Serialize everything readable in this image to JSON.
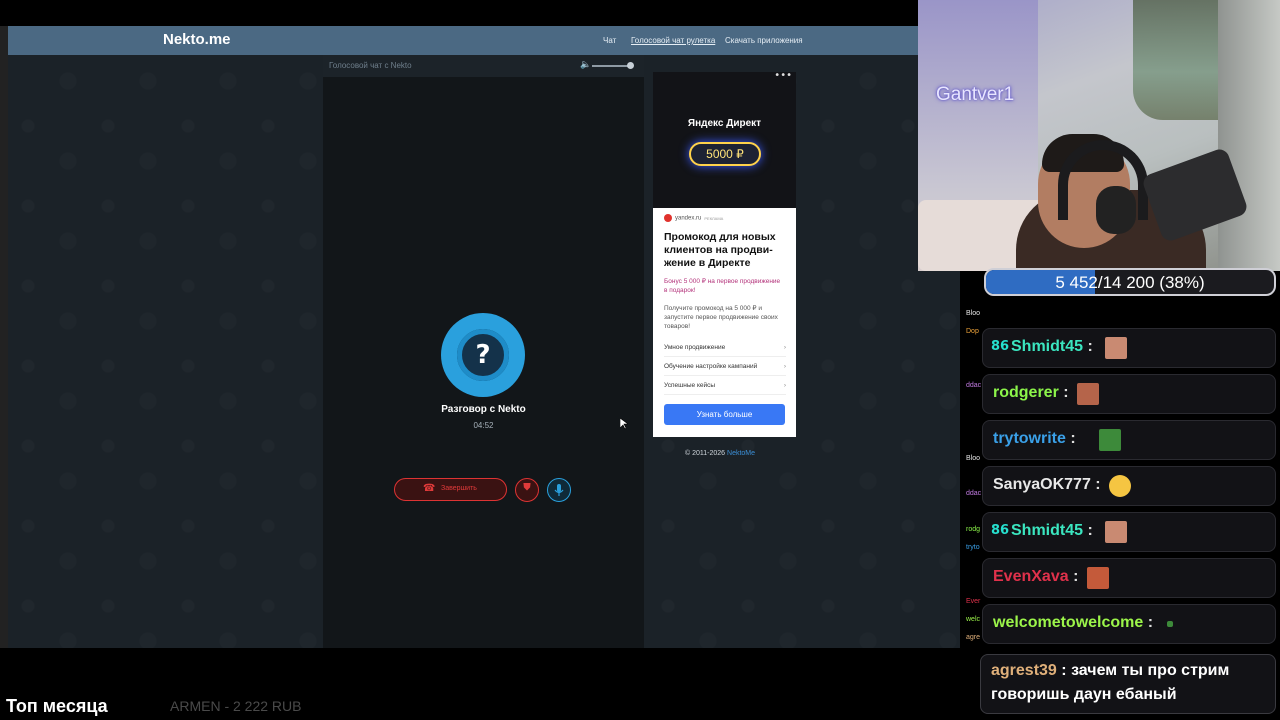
{
  "site": {
    "logo": "Nekto.me",
    "nav": {
      "chat": "Чат",
      "voice": "Голосовой чат рулетка",
      "apps": "Скачать приложения"
    },
    "panel_title": "Голосовой чат с Nekto",
    "peer_avatar_glyph": "?",
    "peer_name": "Разговор с Nekto",
    "timer": "04:52",
    "end_call_label": "Завершить",
    "copyright": "© 2011-2026",
    "copyright_link": "NektoMe"
  },
  "ad": {
    "dots": "•••",
    "brand": "Яндекс Директ",
    "amount": "5000 ₽",
    "source": "yandex.ru",
    "source_tag": "РЕКЛАМА",
    "headline": "Промокод для новых клиентов на продви­жение в Директе",
    "bonus": "Бонус 5 000 ₽ на первое продвижение в подарок!",
    "text": "Получите промокод на 5 000 ₽ и запустите первое продвижение своих товаров!",
    "links": [
      "Умное продвижение",
      "Обучение настройке кампаний",
      "Успешные кейсы"
    ],
    "cta": "Узнать больше"
  },
  "stream": {
    "cam_name": "Gantver1",
    "goal_text": "5 452/14 200 (38%)",
    "goal_fraction": 0.38,
    "bottom_title": "Топ месяца",
    "bottom_donation": "ARMEN - 2 222 RUB"
  },
  "chat": {
    "narrow": [
      "Bloo",
      "Dop",
      "ddac",
      "Bloo",
      "ddac",
      "rodg",
      "tryto",
      "Ever",
      "welc",
      "agre"
    ],
    "messages": [
      {
        "name": "Shmidt45",
        "color": "#3be6c0",
        "badge": "86"
      },
      {
        "name": "rodgerer",
        "color": "#8cf54a",
        "badge": ""
      },
      {
        "name": "trytowrite",
        "color": "#3aa0e8",
        "badge": ""
      },
      {
        "name": "SanyaOK777",
        "color": "#e8e8e8",
        "badge": ""
      },
      {
        "name": "Shmidt45",
        "color": "#3be6c0",
        "badge": "86"
      },
      {
        "name": "EvenXava",
        "color": "#e0314b",
        "badge": ""
      },
      {
        "name": "welcometowelcome",
        "color": "#9cf54a",
        "badge": ""
      }
    ],
    "last": {
      "name": "agrest39",
      "text_line1": "зачем ты про стрим",
      "text_line2": "говоришь даун ебаный"
    },
    "colon": ":"
  }
}
